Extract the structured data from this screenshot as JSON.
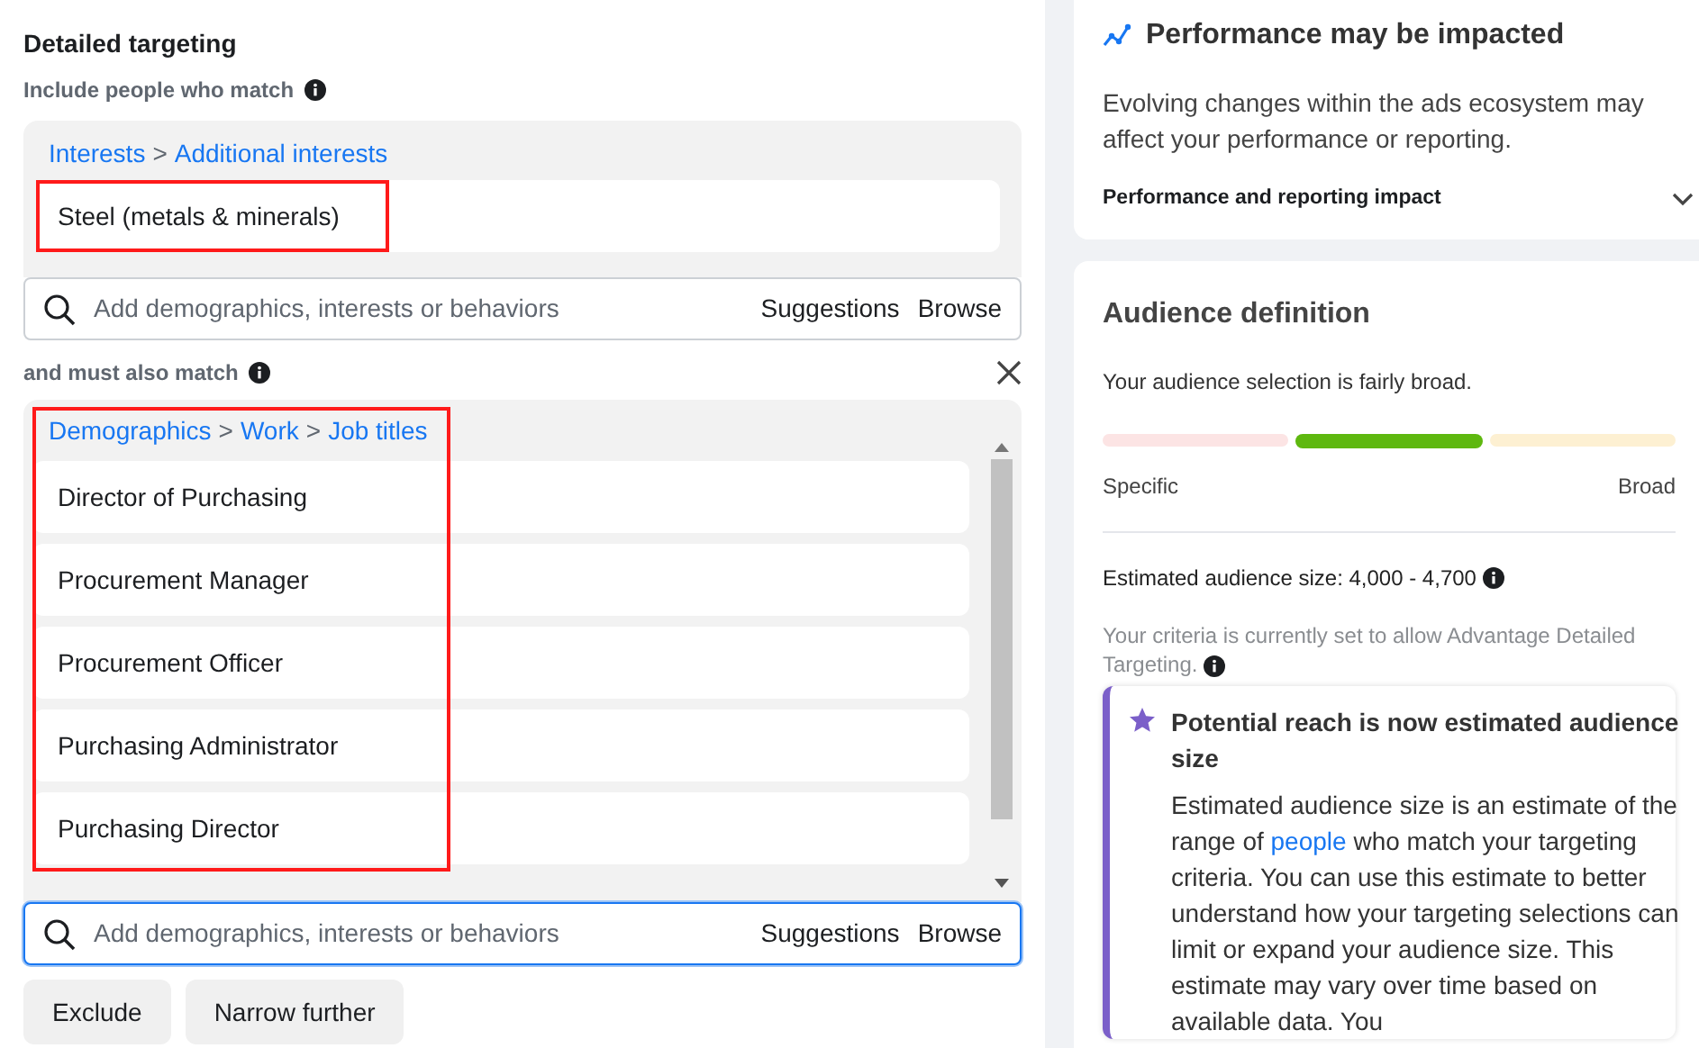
{
  "detailed_targeting": {
    "title": "Detailed targeting",
    "separator": ">",
    "include": {
      "label": "Include people who match",
      "path": [
        "Interests",
        "Additional interests"
      ],
      "highlighted": true,
      "items": [
        "Steel (metals & minerals)"
      ],
      "search": {
        "placeholder": "Add demographics, interests or behaviors",
        "focused": false,
        "actions": [
          "Suggestions",
          "Browse"
        ]
      }
    },
    "narrow": {
      "label": "and must also match",
      "path": [
        "Demographics",
        "Work",
        "Job titles"
      ],
      "highlighted": true,
      "items": [
        "Director of Purchasing",
        "Procurement Manager",
        "Procurement Officer",
        "Purchasing Administrator",
        "Purchasing Director"
      ],
      "search": {
        "placeholder": "Add demographics, interests or behaviors",
        "focused": true,
        "actions": [
          "Suggestions",
          "Browse"
        ]
      }
    },
    "buttons": [
      "Exclude",
      "Narrow further"
    ]
  },
  "performance_card": {
    "title": "Performance may be impacted",
    "body": "Evolving changes within the ads ecosystem may affect your performance or reporting.",
    "expander": {
      "label": "Performance and reporting impact",
      "expanded": false
    }
  },
  "audience_card": {
    "title": "Audience definition",
    "summary": "Your audience selection is fairly broad.",
    "meter": [
      {
        "color": "#fce4e4",
        "selected": false
      },
      {
        "color": "#5eb80f",
        "selected": true
      },
      {
        "color": "#fdf0d2",
        "selected": false
      }
    ],
    "meter_labels": [
      "Specific",
      "Broad"
    ],
    "estimate": "Estimated audience size: 4,000 - 4,700",
    "criteria_note": "Your criteria is currently set to allow Advantage Detailed Targeting.",
    "notice": {
      "title": "Potential reach is now estimated audience size",
      "body_before": "Estimated audience size is an estimate of the range of",
      "link": "people",
      "body_after": "who match your targeting criteria. You can use this estimate to better understand how your targeting selections can limit or expand your audience size. This estimate may vary over time based on available data. You"
    }
  }
}
